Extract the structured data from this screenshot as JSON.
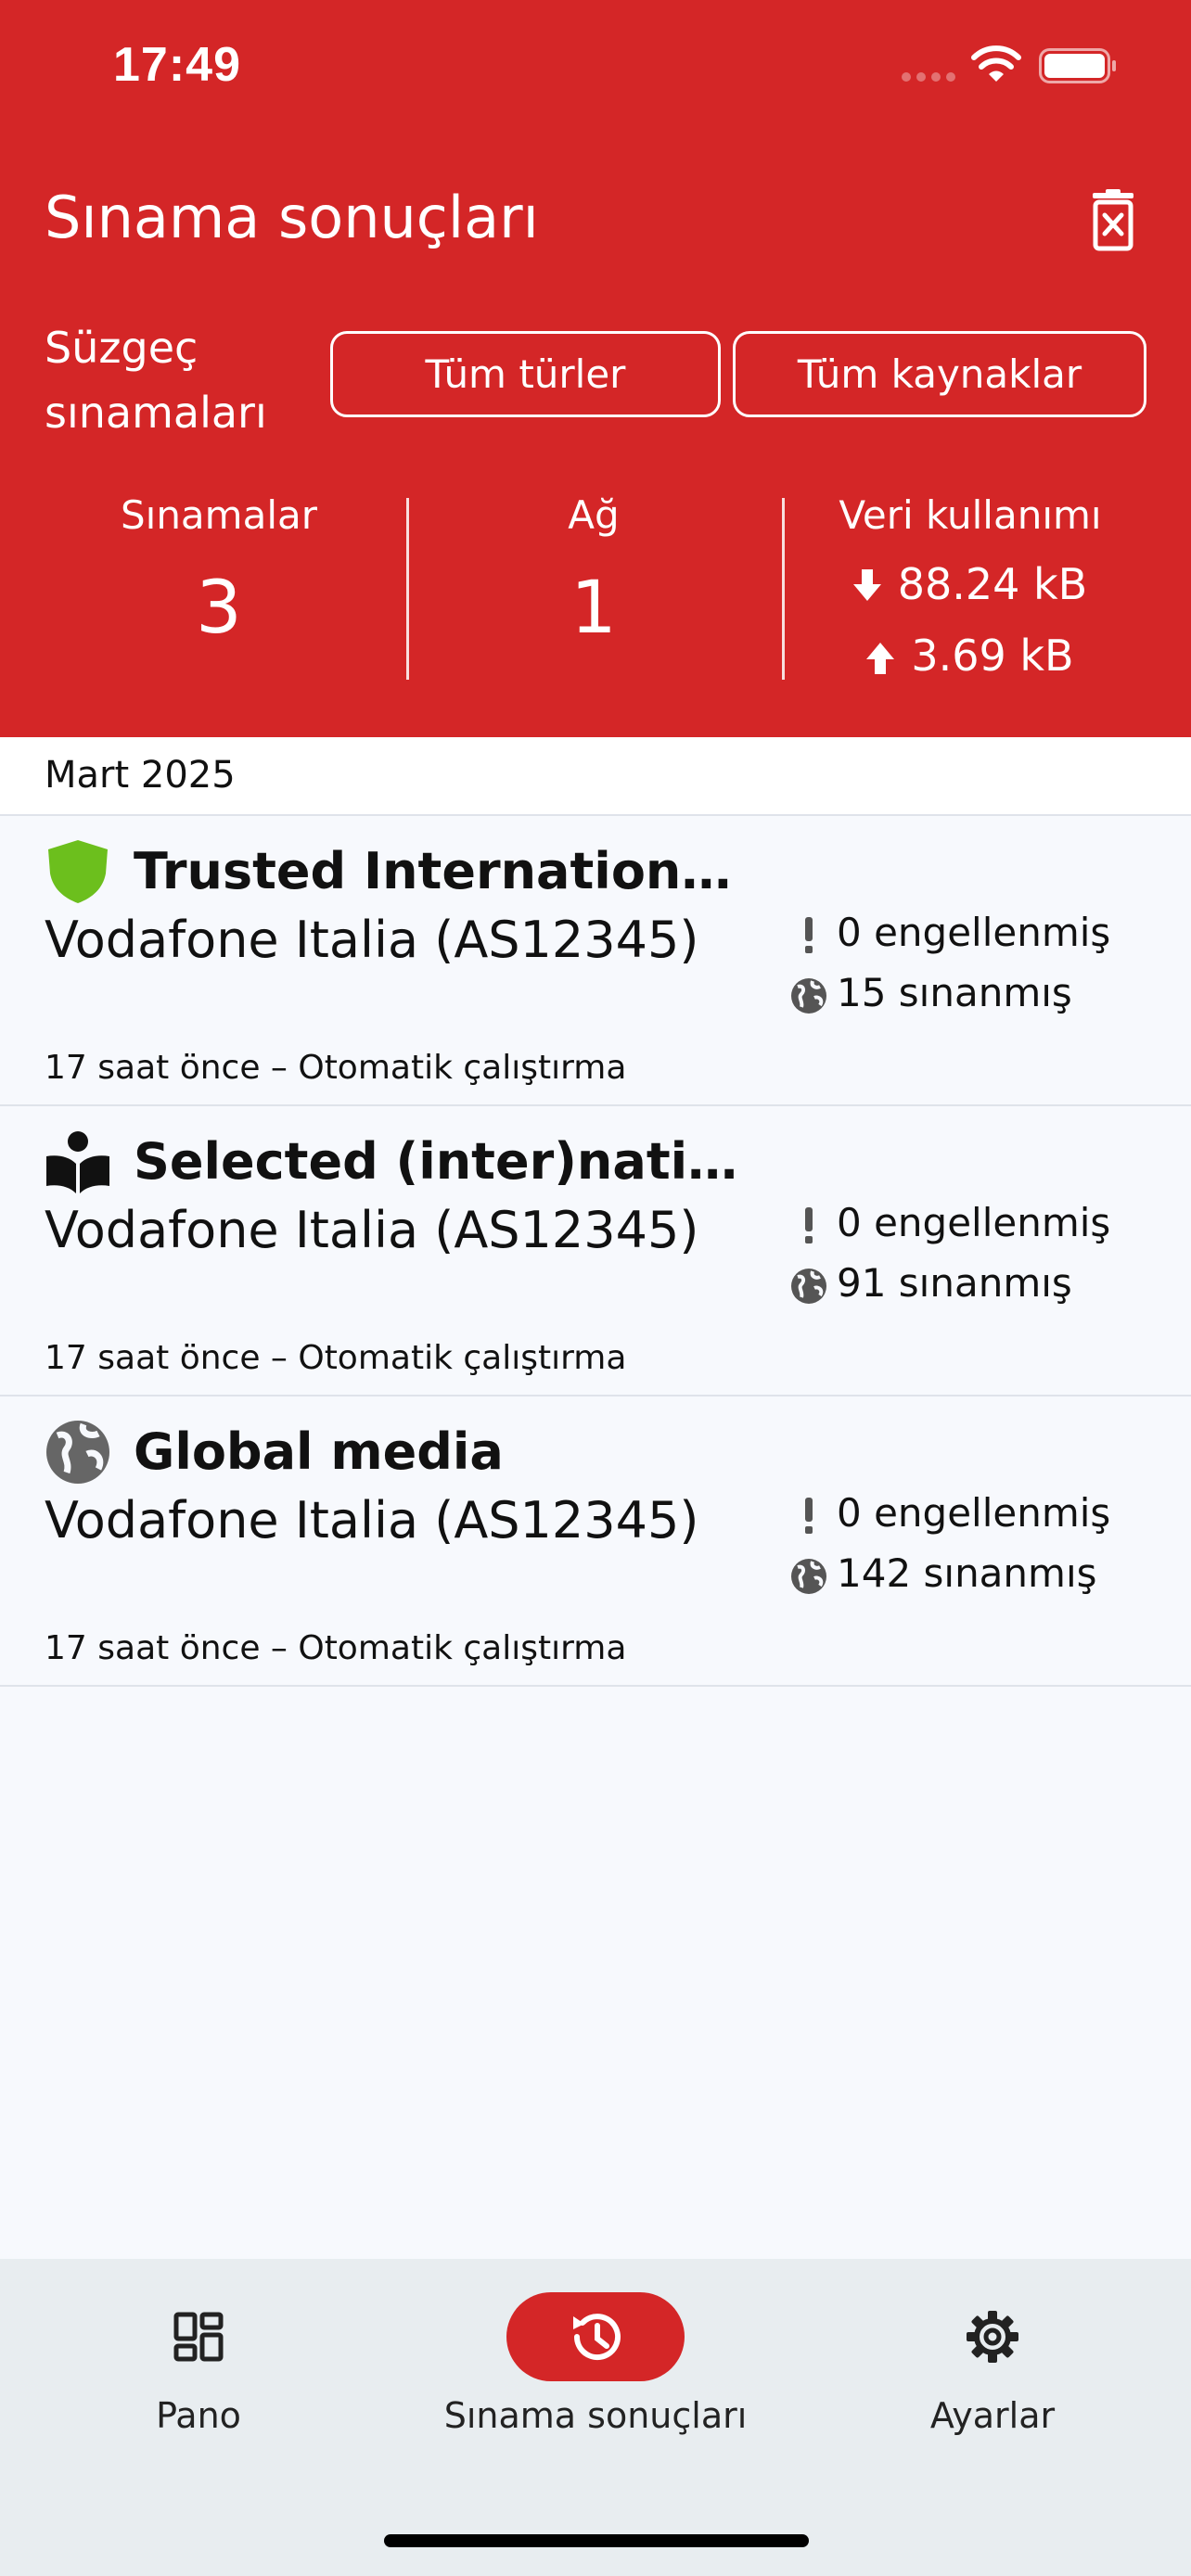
{
  "status_bar": {
    "time": "17:49"
  },
  "header": {
    "title": "Sınama sonuçları",
    "filter_label": "Süzgeç sınamaları",
    "filter_types": "Tüm türler",
    "filter_sources": "Tüm kaynaklar"
  },
  "stats": {
    "tests_label": "Sınamalar",
    "tests_value": "3",
    "networks_label": "Ağ",
    "networks_value": "1",
    "data_label": "Veri kullanımı",
    "download": "88.24 kB",
    "upload": "3.69 kB"
  },
  "month": "Mart 2025",
  "results": [
    {
      "icon": "shield-icon",
      "title": "Trusted International Me...",
      "network": "Vodafone Italia (AS12345)",
      "meta": "17 saat önce – Otomatik çalıştırma",
      "blocked": "0 engellenmiş",
      "tested": "15 sınanmış"
    },
    {
      "icon": "reader-icon",
      "title": "Selected (inter)national ...",
      "network": "Vodafone Italia (AS12345)",
      "meta": "17 saat önce – Otomatik çalıştırma",
      "blocked": "0 engellenmiş",
      "tested": "91 sınanmış"
    },
    {
      "icon": "globe-icon",
      "title": "Global media",
      "network": "Vodafone Italia (AS12345)",
      "meta": "17 saat önce – Otomatik çalıştırma",
      "blocked": "0 engellenmiş",
      "tested": "142 sınanmış"
    }
  ],
  "nav": {
    "dashboard": "Pano",
    "results": "Sınama sonuçları",
    "settings": "Ayarlar"
  },
  "colors": {
    "brand_red": "#d42627",
    "shield_green": "#6cbf1d",
    "globe_gray": "#666666"
  }
}
